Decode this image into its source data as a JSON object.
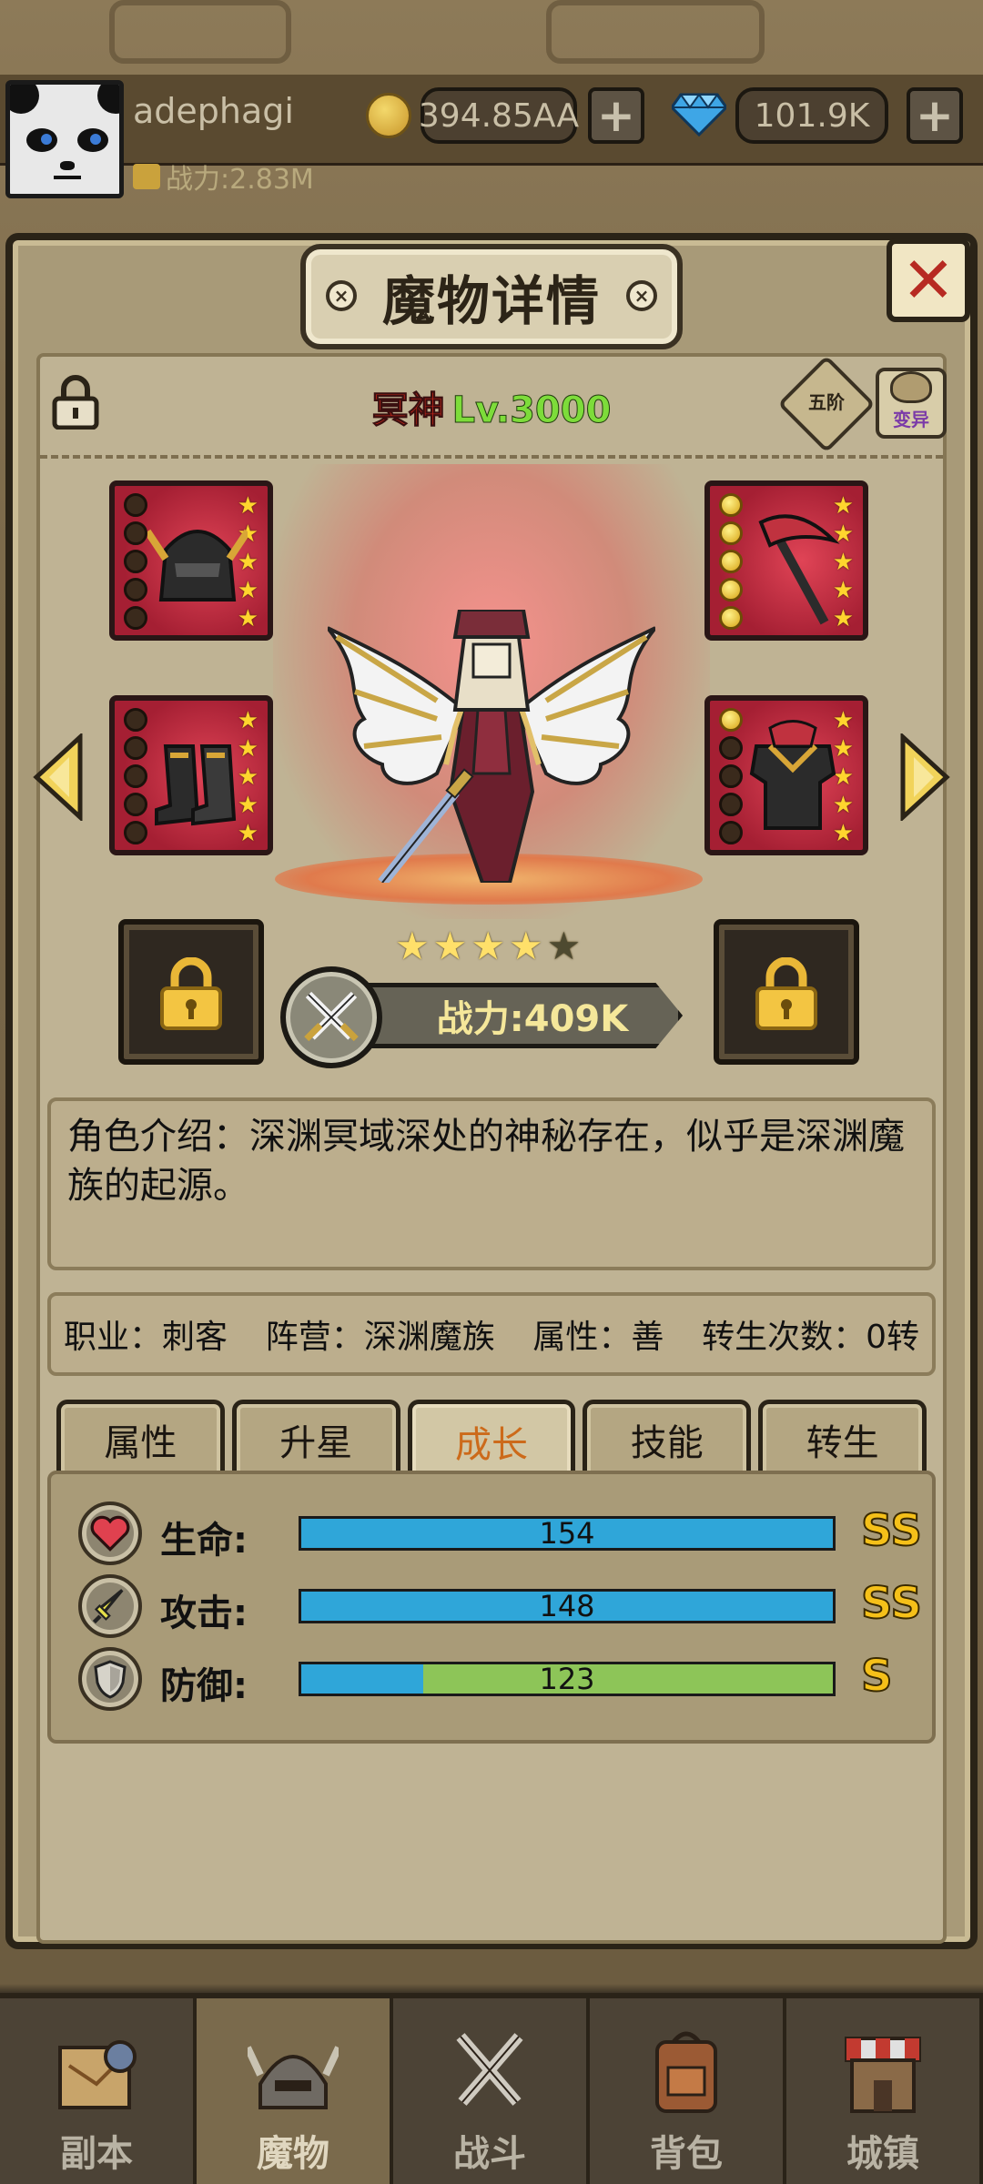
{
  "player": {
    "name": "adephagi",
    "power": "战力:2.83M",
    "coins": "394.85AA",
    "gems": "101.9K"
  },
  "panel": {
    "title": "魔物详情",
    "close_symbol": "✕",
    "hero_name": "冥神",
    "hero_level": "Lv.3000",
    "rank": "五阶",
    "mutate_label": "变异"
  },
  "hero": {
    "stars_filled": 4,
    "stars_total": 5,
    "power": "战力:409K",
    "description": "角色介绍：深渊冥域深处的神秘存在，似乎是深渊魔族的起源。",
    "info": {
      "job": "职业：刺客",
      "faction": "阵营：深渊魔族",
      "attribute": "属性：善",
      "rebirth": "转生次数：0转"
    }
  },
  "tabs": [
    {
      "label": "属性",
      "active": false
    },
    {
      "label": "升星",
      "active": false
    },
    {
      "label": "成长",
      "active": true
    },
    {
      "label": "技能",
      "active": false
    },
    {
      "label": "转生",
      "active": false
    }
  ],
  "growth": [
    {
      "label": "生命:",
      "value": "154",
      "grade": "SS",
      "fill_percent": 100,
      "icon": "heart-icon"
    },
    {
      "label": "攻击:",
      "value": "148",
      "grade": "SS",
      "fill_percent": 100,
      "icon": "sword-icon"
    },
    {
      "label": "防御:",
      "value": "123",
      "grade": "S",
      "fill_percent": 23,
      "icon": "shield-icon"
    }
  ],
  "nav": [
    {
      "label": "副本",
      "active": false
    },
    {
      "label": "魔物",
      "active": true
    },
    {
      "label": "战斗",
      "active": false
    },
    {
      "label": "背包",
      "active": false
    },
    {
      "label": "城镇",
      "active": false
    }
  ],
  "colors": {
    "bar_fill": "#2fa6d9",
    "bar_track": "#8dc558",
    "grade": "#f5c019",
    "hero_name": "#d9281b",
    "level": "#7ddc3a",
    "active_tab_text": "#cc6a1a"
  }
}
